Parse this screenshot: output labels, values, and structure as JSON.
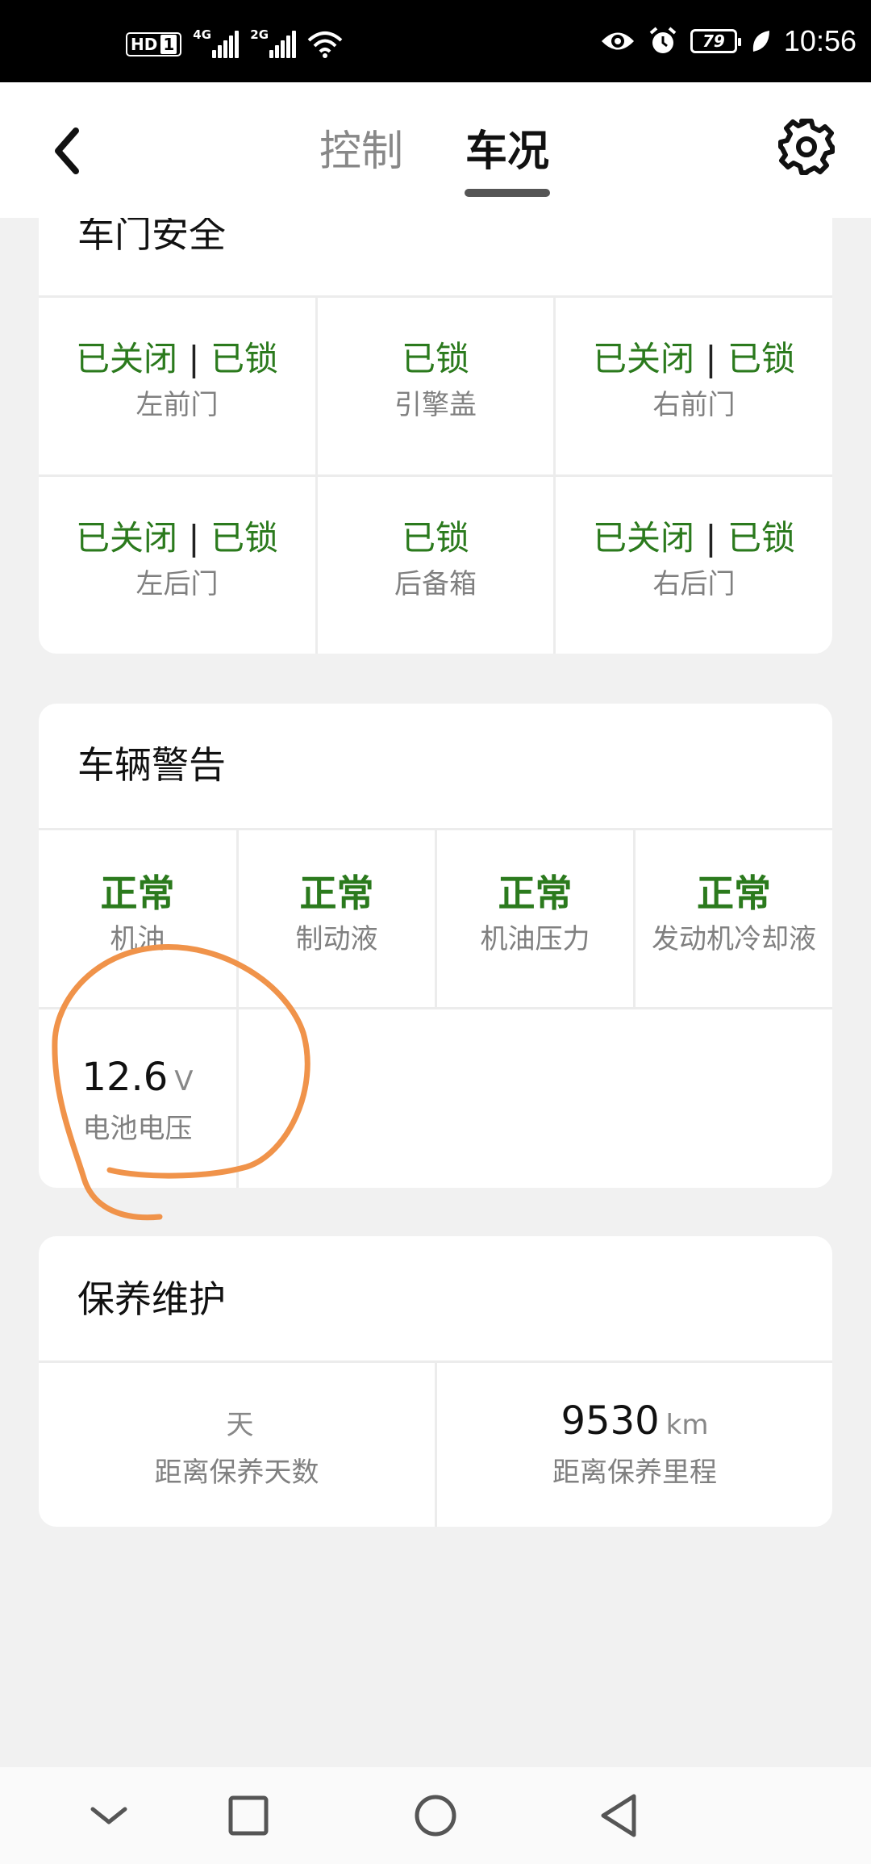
{
  "status_bar": {
    "hd_label": "HD",
    "sim_label": "1",
    "network_1": "4G",
    "network_2": "2G",
    "battery_level": "79",
    "time": "10:56",
    "icons": [
      "wifi-icon",
      "eye-icon",
      "alarm-icon",
      "leaf-icon"
    ]
  },
  "header": {
    "tabs": [
      {
        "label": "控制",
        "active": false
      },
      {
        "label": "车况",
        "active": true
      }
    ],
    "back_icon": "chevron-left-icon",
    "settings_icon": "gear-icon"
  },
  "door_security": {
    "title": "车门安全",
    "separator": "|",
    "cells": [
      {
        "status_a": "已关闭",
        "status_b": "已锁",
        "label": "左前门"
      },
      {
        "status": "已锁",
        "label": "引擎盖"
      },
      {
        "status_a": "已关闭",
        "status_b": "已锁",
        "label": "右前门"
      },
      {
        "status_a": "已关闭",
        "status_b": "已锁",
        "label": "左后门"
      },
      {
        "status": "已锁",
        "label": "后备箱"
      },
      {
        "status_a": "已关闭",
        "status_b": "已锁",
        "label": "右后门"
      }
    ]
  },
  "vehicle_warning": {
    "title": "车辆警告",
    "cells": [
      {
        "status": "正常",
        "label": "机油"
      },
      {
        "status": "正常",
        "label": "制动液"
      },
      {
        "status": "正常",
        "label": "机油压力"
      },
      {
        "status": "正常",
        "label": "发动机冷却液"
      }
    ],
    "battery": {
      "value": "12.6",
      "unit": "V",
      "label": "电池电压"
    }
  },
  "maintenance": {
    "title": "保养维护",
    "days": {
      "value": "",
      "unit": "天",
      "label": "距离保养天数"
    },
    "mileage": {
      "value": "9530",
      "unit": "km",
      "label": "距离保养里程"
    }
  },
  "colors": {
    "ok_green": "#2b7a1d",
    "annotation_orange": "#f0934a"
  }
}
